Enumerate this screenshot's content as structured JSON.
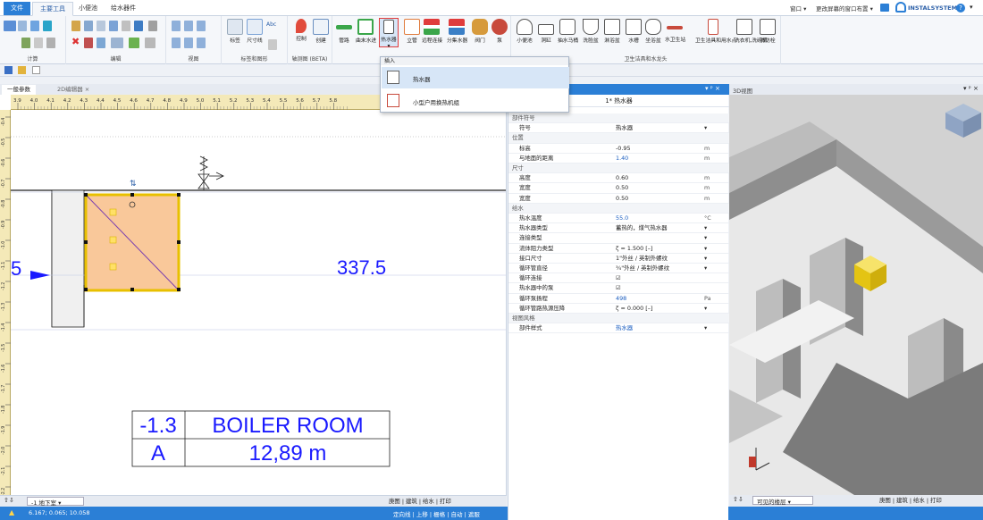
{
  "tabs": {
    "file": "文件",
    "main": "主要工具",
    "toilet": "小便池",
    "supply": "给水器件"
  },
  "topright": {
    "window": "窗口",
    "layout": "更改屏幕的窗口布置",
    "brand": "INSTALSYSTEM"
  },
  "ribbon": {
    "groups": {
      "calc": "计算",
      "edit": "编辑",
      "view": "视图",
      "labels": "标签和图形",
      "axono": "轴测图 (BETA)",
      "fixtures": "卫生洁具和水龙头"
    },
    "buttons": {
      "label": "标签",
      "dim": "尺寸线",
      "abc": "Abc",
      "control": "控制",
      "create": "创建",
      "pipe": "管路",
      "end": "曲末水进",
      "heater": "热水器",
      "riser": "立管",
      "remote": "远程连接",
      "manifold": "分集水器",
      "valve": "阀门",
      "pump": "泵",
      "urinal": "小便池",
      "basin2": "洞缸",
      "toilet": "抽水马桶",
      "washbasin": "洗脸盆",
      "shower": "淋浴盆",
      "sink": "水槽",
      "bidet": "坐浴盆",
      "tapwc": "水卫生站",
      "fixtures": "卫生洁具和用水点",
      "washer": "洗衣机,洗碗机",
      "tap": "消防栓"
    }
  },
  "menu": {
    "header": "插入",
    "item1": "热水器",
    "item2": "小型户用换热机组"
  },
  "doctabs": {
    "tab1": "一般参数",
    "tab2": "2D编辑器"
  },
  "ruler": {
    "ticks": [
      "3.9",
      "4.0",
      "4.1",
      "4.2",
      "4.3",
      "4.4",
      "4.5",
      "4.6",
      "4.7",
      "4.8",
      "4.9",
      "5.0",
      "5.1",
      "5.2",
      "5.3",
      "5.4",
      "5.5",
      "5.6",
      "5.7",
      "5.8"
    ],
    "vticks": [
      "-0.4",
      "-0.5",
      "-0.6",
      "-0.7",
      "-0.8",
      "-0.9",
      "-1.0",
      "-1.1",
      "-1.2",
      "-1.3",
      "-1.4",
      "-1.5",
      "-1.6",
      "-1.7",
      "-1.8",
      "-1.9",
      "-2.0",
      "-2.1",
      "-2.2"
    ]
  },
  "canvas": {
    "dim_left": "5",
    "dim_right": "337.5",
    "room_level": "-1.3",
    "room_name": "BOILER ROOM",
    "room_id": "A",
    "room_area": "12,89 m"
  },
  "bottombar": {
    "level": "-1 地下室",
    "tabs": [
      "庚图",
      "建筑",
      "给水",
      "打印"
    ]
  },
  "status": {
    "coords": "6.167; 0.065; 10.058",
    "right1": "定向线",
    "right2": "上移",
    "right3": "栅格",
    "right4": "自动",
    "right5": "遮服"
  },
  "props": {
    "title": "1* 热水器",
    "rows": [
      {
        "type": "sec",
        "k": "部件符号"
      },
      {
        "k": "符号",
        "v": "热水器",
        "dd": "▾"
      },
      {
        "type": "sec",
        "k": "位置"
      },
      {
        "k": "标高",
        "v": "-0.95",
        "u": "m"
      },
      {
        "k": "与地面的距离",
        "v": "1.40",
        "u": "m",
        "blue": true
      },
      {
        "type": "sec",
        "k": "尺寸"
      },
      {
        "k": "高度",
        "v": "0.60",
        "u": "m"
      },
      {
        "k": "宽度",
        "v": "0.50",
        "u": "m"
      },
      {
        "k": "宽度",
        "v": "0.50",
        "u": "m"
      },
      {
        "type": "sec",
        "k": "给水"
      },
      {
        "k": "热水温度",
        "v": "55.0",
        "u": "°C",
        "blue": true
      },
      {
        "k": "热水器类型",
        "v": "蓄热的，煤气热水器",
        "dd": "▾"
      },
      {
        "k": "连接类型",
        "v": "",
        "dd": "▾"
      },
      {
        "k": "流体阻力类型",
        "v": "ζ = 1.500 [–]",
        "dd": "▾"
      },
      {
        "k": "接口尺寸",
        "v": "1\"外丝 / 英制外螺纹",
        "dd": "▾"
      },
      {
        "k": "循环管直径",
        "v": "¾\"外丝 / 英制外螺纹",
        "dd": "▾"
      },
      {
        "k": "循环连接",
        "v": "☑"
      },
      {
        "k": "热水器中的泵",
        "v": "☑"
      },
      {
        "k": "循环泵扬程",
        "v": "498",
        "u": "Pa",
        "blue": true
      },
      {
        "k": "循环管路热源压降",
        "v": "ζ = 0.000 [–]",
        "dd": "▾"
      },
      {
        "type": "sec",
        "k": "视图风格"
      },
      {
        "k": "部件样式",
        "v": "热水器",
        "dd": "▾",
        "blue": true
      }
    ]
  },
  "view3d": {
    "title": "3D视图",
    "visible": "可见的楼层",
    "tabs": [
      "庚图",
      "建筑",
      "给水",
      "打印"
    ]
  },
  "colors": {
    "accent": "#2b7fd6",
    "heater_fill": "#f9c89a",
    "heater_border": "#e8c000",
    "dim_blue": "#1a1aff",
    "cube": "#f2d21b"
  }
}
